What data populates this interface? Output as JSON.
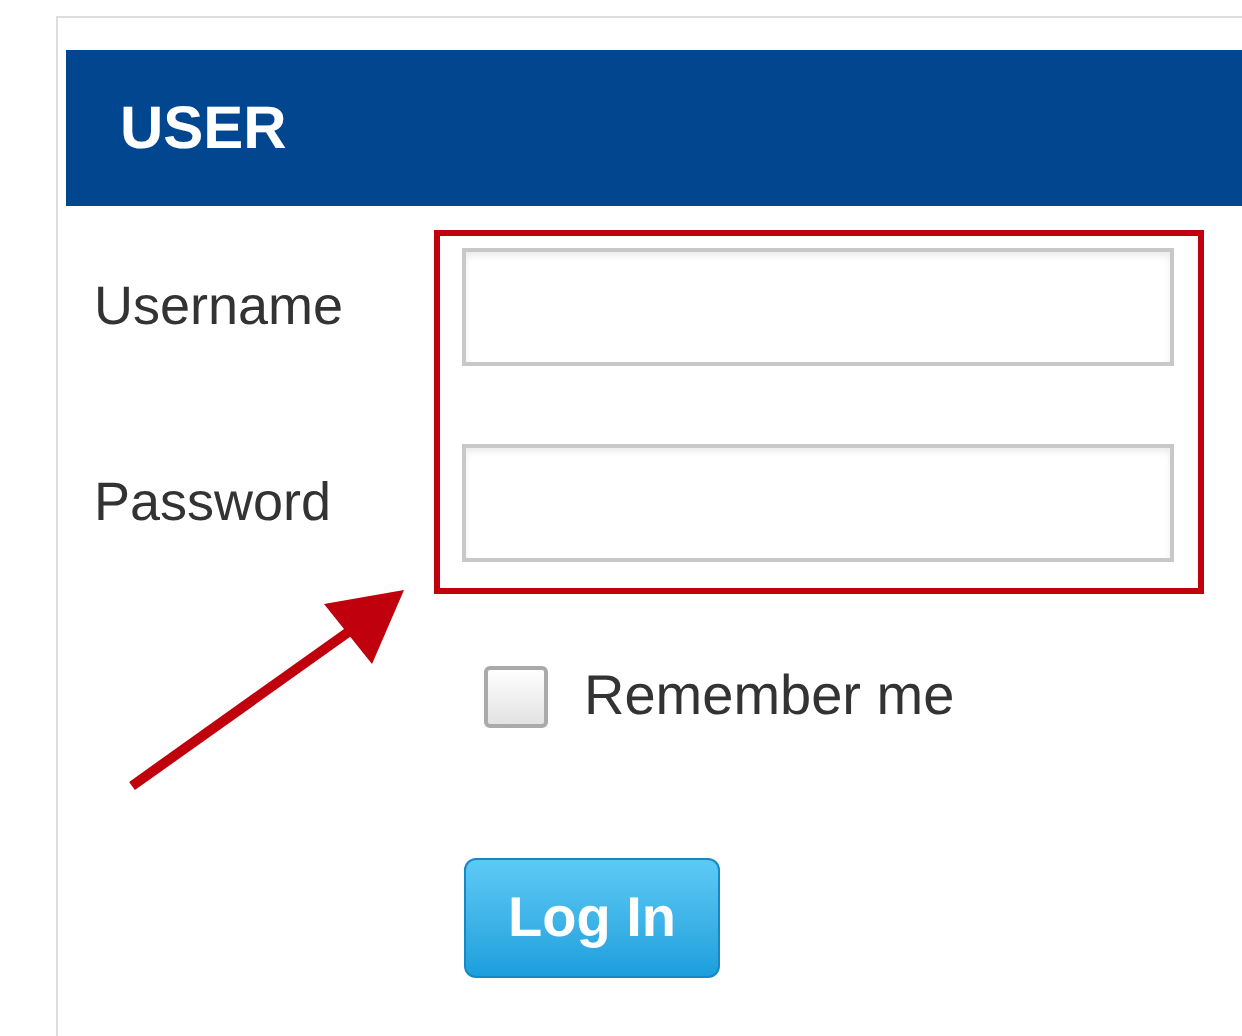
{
  "header": {
    "title": "USER"
  },
  "fields": [
    {
      "label": "Username"
    },
    {
      "label": "Password"
    }
  ],
  "remember": {
    "label": "Remember me",
    "checked": false
  },
  "button": {
    "label": "Log In"
  }
}
